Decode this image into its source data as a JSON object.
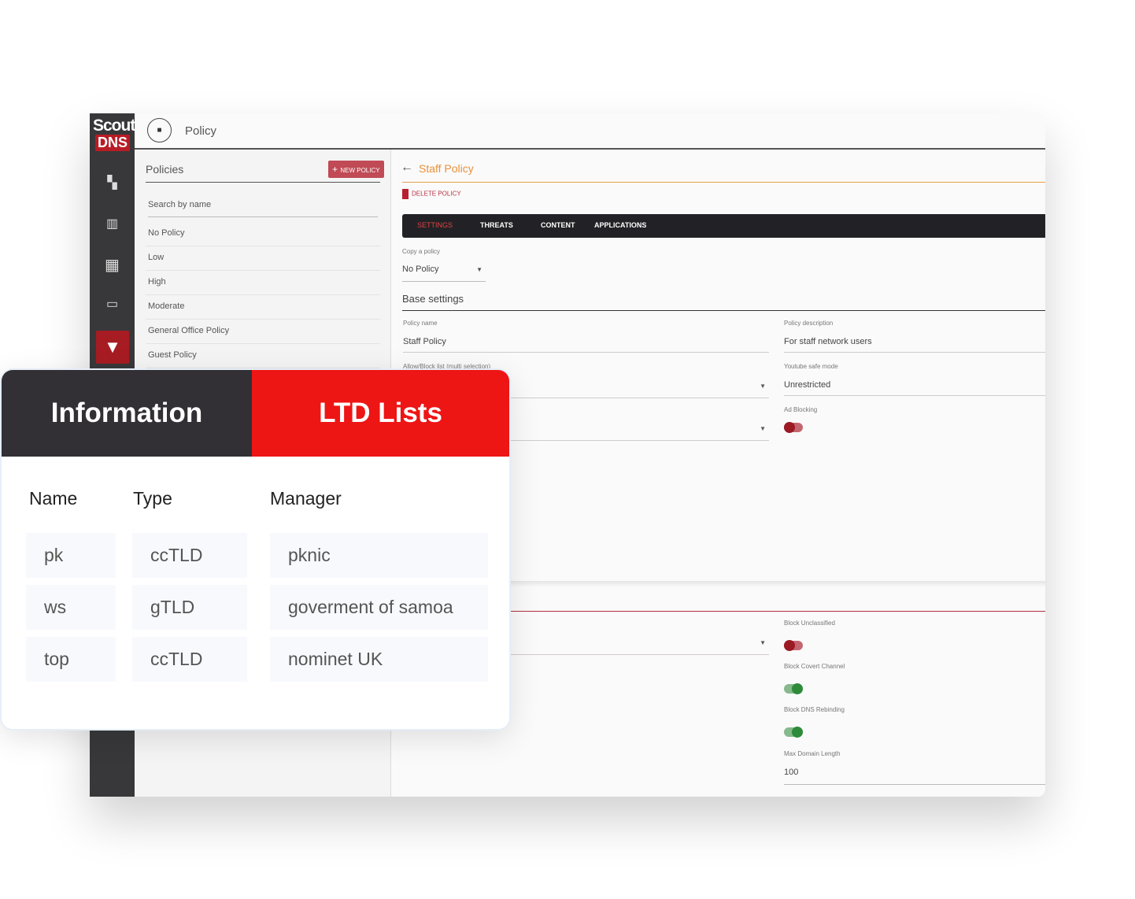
{
  "app": {
    "logo_top": "Scout",
    "logo_bottom": "DNS",
    "page_title": "Policy"
  },
  "sidebar": {
    "icons": [
      "dashboard-icon",
      "chart-icon",
      "building-icon",
      "devices-icon",
      "filter-icon"
    ]
  },
  "policies": {
    "title": "Policies",
    "new_button": "NEW POLICY",
    "search_placeholder": "Search by name",
    "items": [
      "No Policy",
      "Low",
      "High",
      "Moderate",
      "General Office Policy",
      "Guest Policy"
    ]
  },
  "detail": {
    "title": "Staff Policy",
    "delete": "DELETE POLICY",
    "tabs": [
      "SETTINGS",
      "THREATS",
      "CONTENT",
      "APPLICATIONS"
    ],
    "active_tab": "SETTINGS",
    "copy_label": "Copy a policy",
    "copy_value": "No Policy",
    "section": "Base settings",
    "policy_name_label": "Policy name",
    "policy_name": "Staff Policy",
    "policy_desc_label": "Policy description",
    "policy_desc": "For staff network users",
    "allow_block_label": "Allow/Block list (multi selection)",
    "youtube_label": "Youtube safe mode",
    "youtube_value": "Unrestricted",
    "ad_blocking_label": "Ad Blocking",
    "ad_blocking": false,
    "block_unclassified_label": "Block Unclassified",
    "block_unclassified": false,
    "block_covert_label": "Block Covert Channel",
    "block_covert": true,
    "block_rebinding_label": "Block DNS Rebinding",
    "block_rebinding": true,
    "max_domain_label": "Max Domain Length",
    "max_domain": "100"
  },
  "card": {
    "tabs": [
      "Information",
      "LTD Lists"
    ],
    "active_tab": "LTD Lists",
    "headers": [
      "Name",
      "Type",
      "Manager"
    ],
    "rows": [
      [
        "pk",
        "ccTLD",
        "pknic"
      ],
      [
        "ws",
        "gTLD",
        "goverment of samoa"
      ],
      [
        "top",
        "ccTLD",
        "nominet UK"
      ]
    ]
  },
  "colors": {
    "accent_red": "#ee1515",
    "dark": "#323035",
    "orange": "#e8913a",
    "toggle_off": "#9b1a24",
    "toggle_on": "#2e8b3a"
  }
}
